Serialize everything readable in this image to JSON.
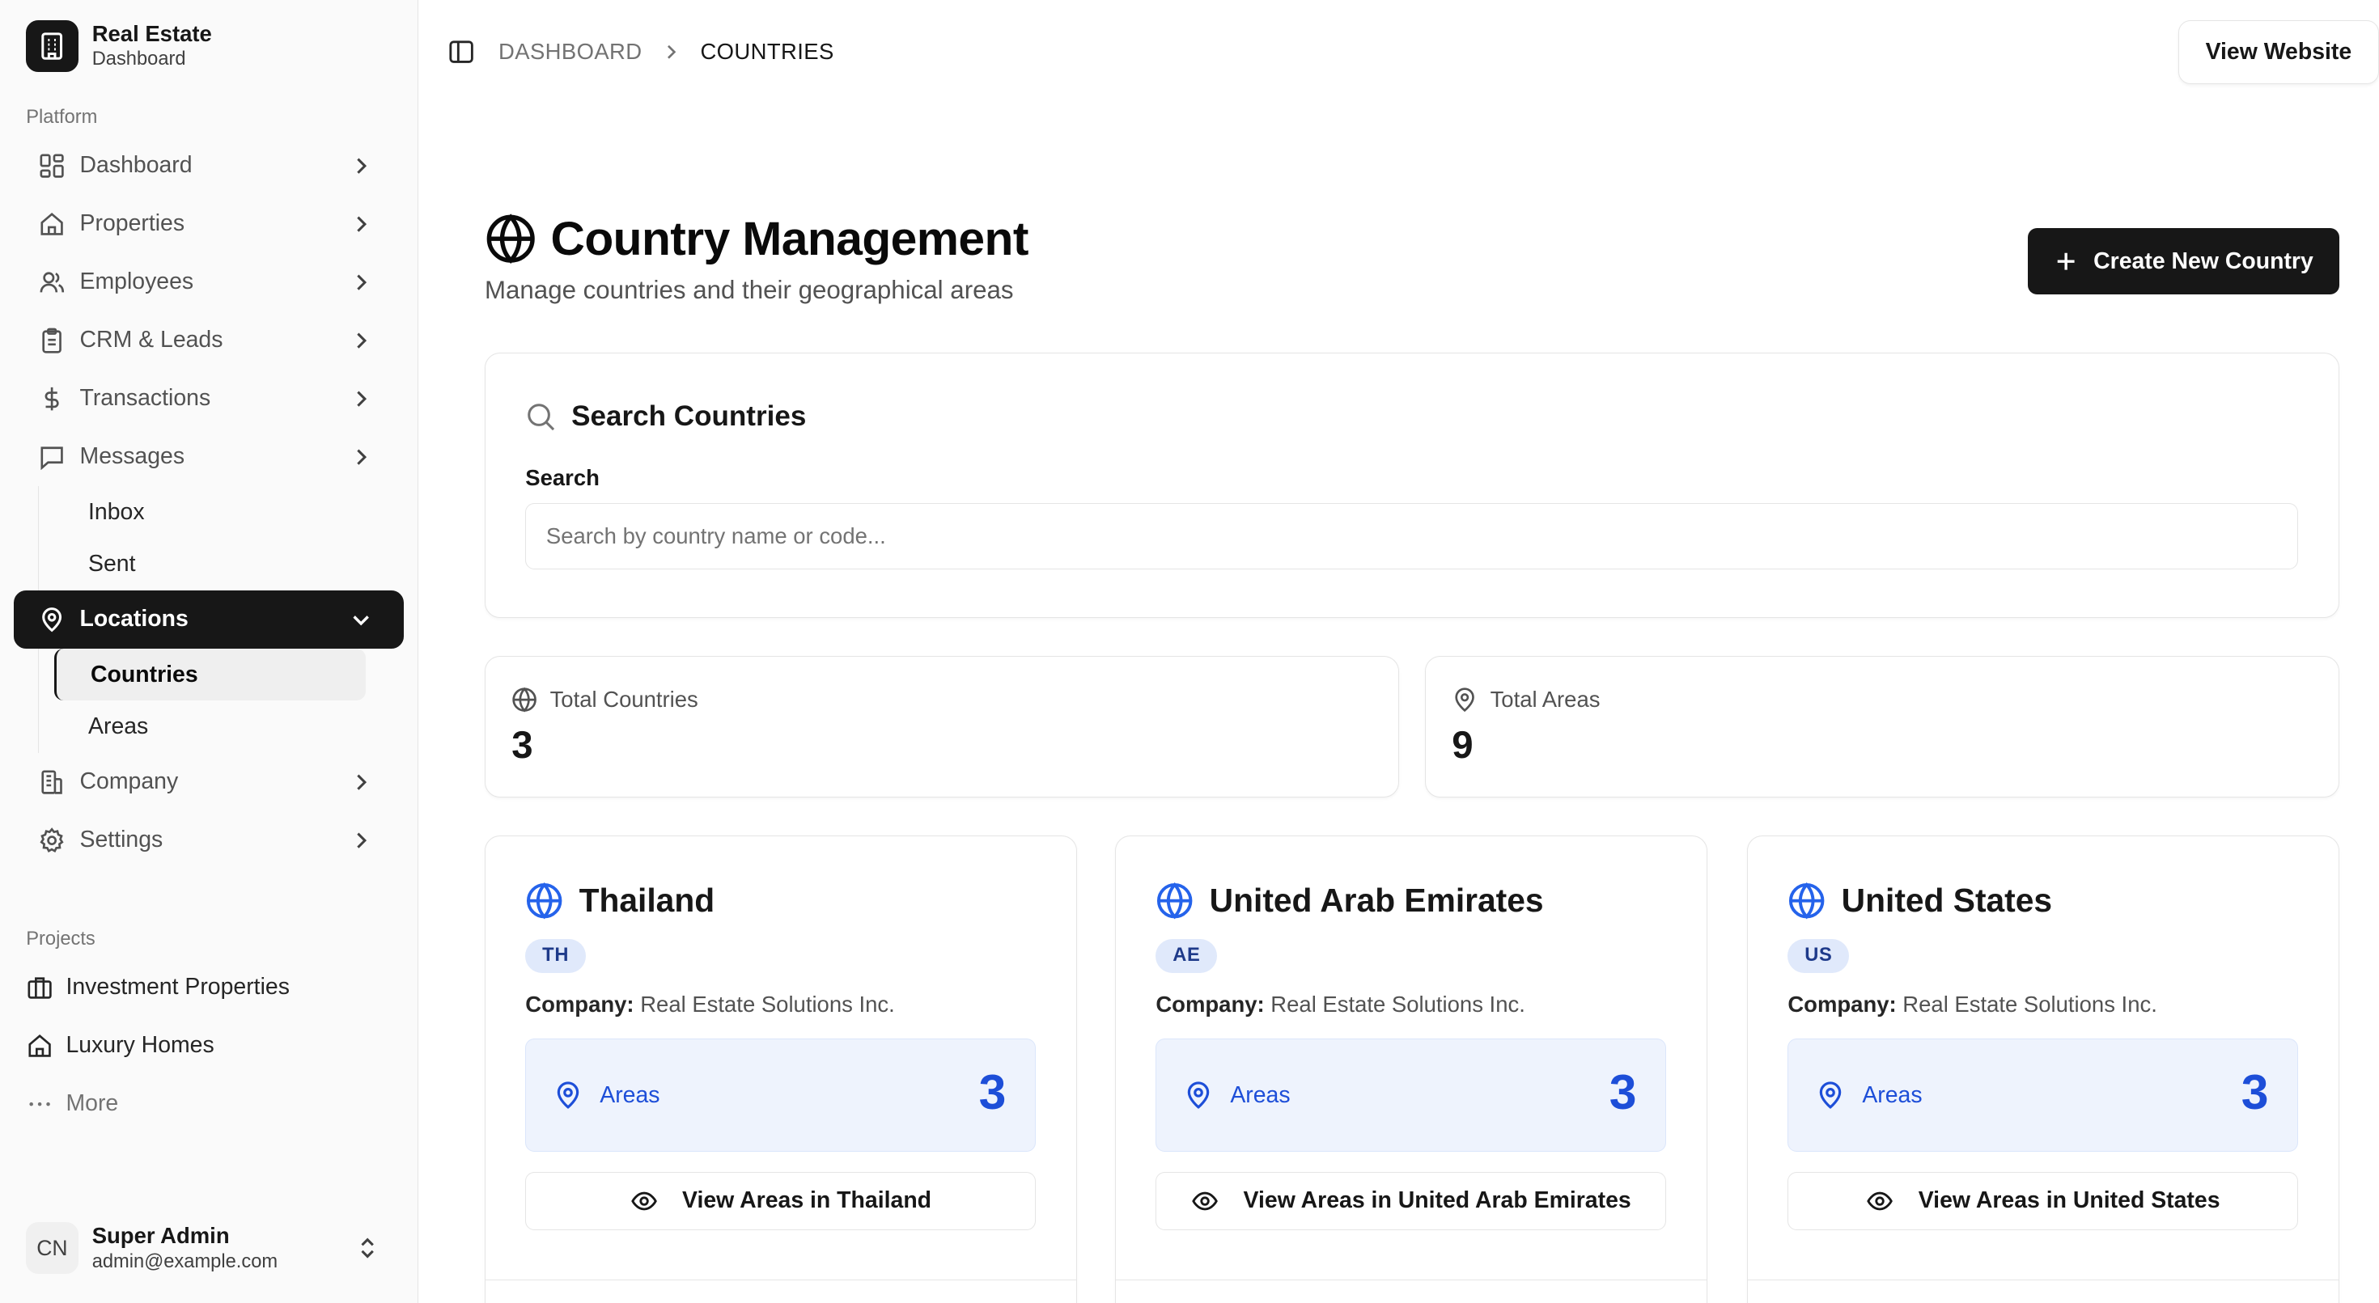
{
  "brand": {
    "title": "Real Estate",
    "subtitle": "Dashboard",
    "icon": "building-icon"
  },
  "sidebar": {
    "platform_label": "Platform",
    "items": [
      {
        "label": "Dashboard",
        "icon": "dashboard-icon"
      },
      {
        "label": "Properties",
        "icon": "home-icon"
      },
      {
        "label": "Employees",
        "icon": "users-icon"
      },
      {
        "label": "CRM & Leads",
        "icon": "clipboard-icon"
      },
      {
        "label": "Transactions",
        "icon": "dollar-icon"
      },
      {
        "label": "Messages",
        "icon": "message-icon"
      },
      {
        "label": "Locations",
        "icon": "map-pin-icon"
      },
      {
        "label": "Company",
        "icon": "building-icon"
      },
      {
        "label": "Settings",
        "icon": "gear-icon"
      }
    ],
    "messages_sub": [
      "Inbox",
      "Sent"
    ],
    "locations_sub": [
      "Countries",
      "Areas"
    ],
    "projects_label": "Projects",
    "projects": [
      {
        "label": "Investment Properties",
        "icon": "briefcase-icon"
      },
      {
        "label": "Luxury Homes",
        "icon": "home-icon"
      },
      {
        "label": "More",
        "icon": "more-icon"
      }
    ],
    "user": {
      "initials": "CN",
      "name": "Super Admin",
      "email": "admin@example.com"
    }
  },
  "topbar": {
    "breadcrumb_root": "DASHBOARD",
    "breadcrumb_current": "COUNTRIES",
    "view_website": "View Website"
  },
  "page": {
    "title": "Country Management",
    "subtitle": "Manage countries and their geographical areas",
    "create_button": "Create New Country"
  },
  "search": {
    "title": "Search Countries",
    "label": "Search",
    "placeholder": "Search by country name or code...",
    "value": ""
  },
  "stats": {
    "countries_label": "Total Countries",
    "countries_value": "3",
    "areas_label": "Total Areas",
    "areas_value": "9"
  },
  "countries": [
    {
      "name": "Thailand",
      "code": "TH",
      "company_label": "Company:",
      "company": "Real Estate Solutions Inc.",
      "areas_label": "Areas",
      "areas_count": "3",
      "view_label": "View Areas in Thailand"
    },
    {
      "name": "United Arab Emirates",
      "code": "AE",
      "company_label": "Company:",
      "company": "Real Estate Solutions Inc.",
      "areas_label": "Areas",
      "areas_count": "3",
      "view_label": "View Areas in United Arab Emirates"
    },
    {
      "name": "United States",
      "code": "US",
      "company_label": "Company:",
      "company": "Real Estate Solutions Inc.",
      "areas_label": "Areas",
      "areas_count": "3",
      "view_label": "View Areas in United States"
    }
  ],
  "colors": {
    "primary": "#171717",
    "accent_blue": "#1d4ed8",
    "badge_bg": "#e0e9fb",
    "areas_bg": "#eef3fd"
  }
}
